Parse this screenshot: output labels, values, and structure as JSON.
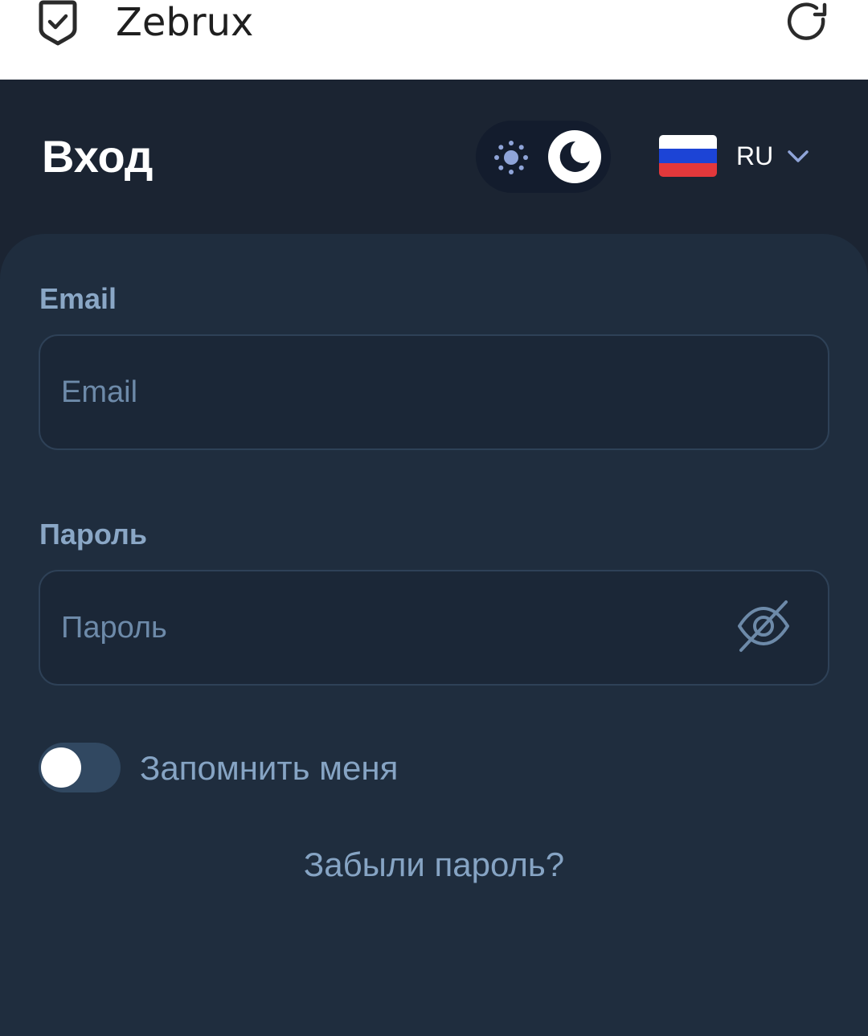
{
  "app": {
    "title": "Zebrux"
  },
  "header": {
    "title": "Вход",
    "language_code": "RU",
    "theme_mode": "dark"
  },
  "form": {
    "email_label": "Email",
    "email_placeholder": "Email",
    "password_label": "Пароль",
    "password_placeholder": "Пароль",
    "remember_label": "Запомнить меня",
    "remember_on": false,
    "forgot_link": "Забыли пароль?"
  },
  "colors": {
    "background": "#1b2432",
    "card": "#1f2d3e",
    "label": "#8aa7c6",
    "placeholder": "#6d8aa9",
    "flag_white": "#ffffff",
    "flag_blue": "#1c44d6",
    "flag_red": "#e3383b"
  },
  "icons": [
    "shield-check-icon",
    "reload-icon",
    "sun-icon",
    "moon-icon",
    "chevron-down-icon",
    "eye-off-icon"
  ]
}
